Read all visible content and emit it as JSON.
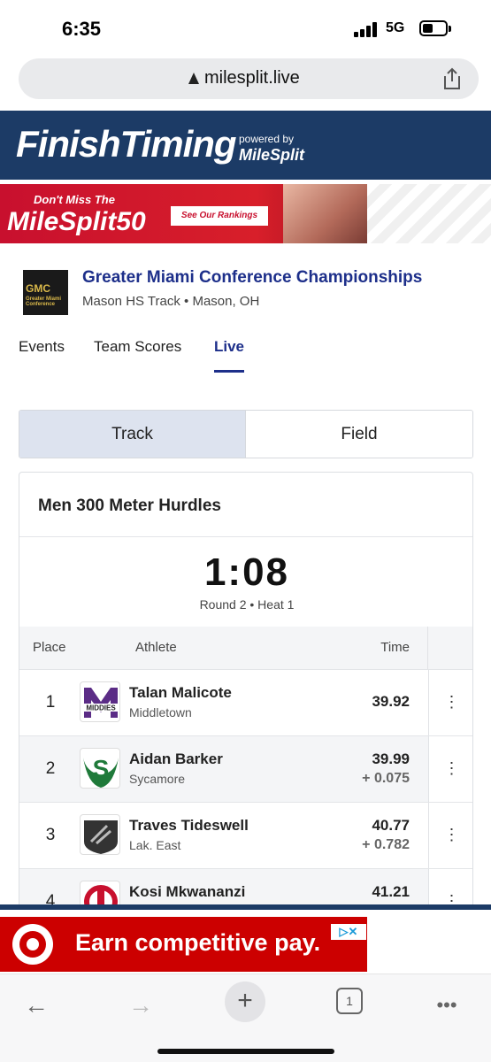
{
  "status": {
    "time": "6:35",
    "network": "5G"
  },
  "browser": {
    "url": "milesplit.live"
  },
  "header": {
    "logo": "FinishTiming",
    "powered_by": "powered by",
    "powered_brand": "MileSplit"
  },
  "ad_top": {
    "line1": "Don't Miss The",
    "line2": "MileSplit50",
    "button": "See Our Rankings"
  },
  "meet": {
    "logo_text": "Greater Miami Conference",
    "title": "Greater Miami Conference Championships",
    "location": "Mason HS Track • Mason, OH"
  },
  "tabs": [
    {
      "label": "Events"
    },
    {
      "label": "Team Scores"
    },
    {
      "label": "Live",
      "active": true
    }
  ],
  "segment": {
    "track": "Track",
    "field": "Field"
  },
  "event": {
    "title": "Men 300 Meter Hurdles",
    "clock": "1:08",
    "round": "Round 2 • Heat 1"
  },
  "table": {
    "headers": {
      "place": "Place",
      "athlete": "Athlete",
      "time": "Time"
    },
    "rows": [
      {
        "place": "1",
        "name": "Talan Malicote",
        "team": "Middletown",
        "time": "39.92",
        "gap": "",
        "logo": "middies-logo-icon",
        "color": "#5b2c86"
      },
      {
        "place": "2",
        "name": "Aidan Barker",
        "team": "Sycamore",
        "time": "39.99",
        "gap": "+ 0.075",
        "logo": "sycamore-logo-icon",
        "color": "#1f7a3a"
      },
      {
        "place": "3",
        "name": "Traves Tideswell",
        "team": "Lak. East",
        "time": "40.77",
        "gap": "+ 0.782",
        "logo": "lakota-east-logo-icon",
        "color": "#333333"
      },
      {
        "place": "4",
        "name": "Kosi Mkwananzi",
        "team": "",
        "time": "41.21",
        "gap": "",
        "logo": "cincinnati-logo-icon",
        "color": "#c8102e"
      }
    ]
  },
  "ad_bottom": {
    "text": "Earn competitive pay."
  },
  "toolbar": {
    "tab_count": "1"
  },
  "colors": {
    "brand_navy": "#1c3b66",
    "link_blue": "#1d2f8a",
    "ad_red": "#cc0000"
  }
}
